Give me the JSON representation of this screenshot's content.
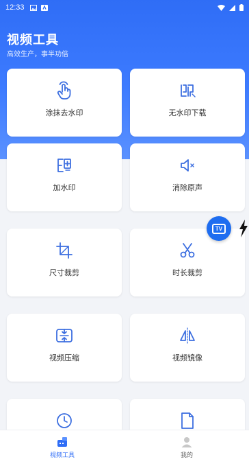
{
  "status_bar": {
    "time": "12:33"
  },
  "header": {
    "title": "视频工具",
    "subtitle": "高效生产，事半功倍"
  },
  "tools": [
    {
      "label": "涂抹去水印",
      "icon": "smear-hand-icon"
    },
    {
      "label": "无水印下载",
      "icon": "no-watermark-icon"
    },
    {
      "label": "加水印",
      "icon": "add-watermark-icon"
    },
    {
      "label": "消除原声",
      "icon": "mute-speaker-icon"
    },
    {
      "label": "尺寸裁剪",
      "icon": "crop-icon"
    },
    {
      "label": "时长裁剪",
      "icon": "scissors-icon"
    },
    {
      "label": "视频压缩",
      "icon": "compress-icon"
    },
    {
      "label": "视频镜像",
      "icon": "mirror-icon"
    },
    {
      "label": "",
      "icon": "clock-icon"
    },
    {
      "label": "",
      "icon": "document-icon"
    }
  ],
  "fab": {
    "label": "TV"
  },
  "bottom_nav": [
    {
      "label": "视频工具",
      "icon": "video-tools-icon",
      "active": true
    },
    {
      "label": "我的",
      "icon": "profile-icon",
      "active": false
    }
  ],
  "colors": {
    "accent": "#2f6df6",
    "icon": "#3d6fe0"
  }
}
